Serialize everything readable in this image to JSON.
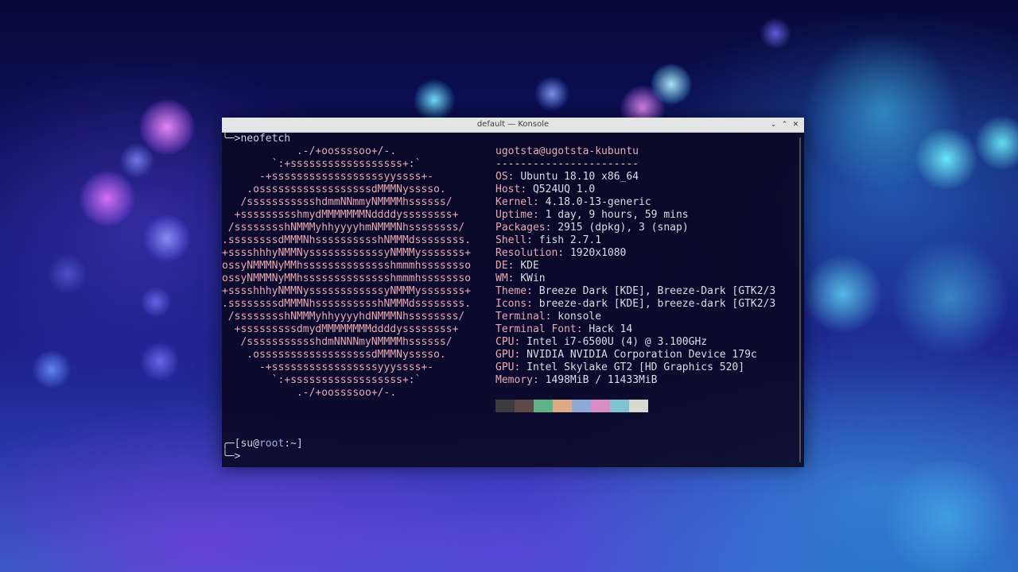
{
  "window": {
    "title": "default — Konsole"
  },
  "terminal": {
    "command_line": "╰─>neofetch",
    "header": "ugotsta@ugotsta-kubuntu",
    "separator": "-----------------------",
    "info": [
      {
        "key": "OS",
        "value": "Ubuntu 18.10 x86_64"
      },
      {
        "key": "Host",
        "value": "Q524UQ 1.0"
      },
      {
        "key": "Kernel",
        "value": "4.18.0-13-generic"
      },
      {
        "key": "Uptime",
        "value": "1 day, 9 hours, 59 mins"
      },
      {
        "key": "Packages",
        "value": "2915 (dpkg), 3 (snap)"
      },
      {
        "key": "Shell",
        "value": "fish 2.7.1"
      },
      {
        "key": "Resolution",
        "value": "1920x1080"
      },
      {
        "key": "DE",
        "value": "KDE"
      },
      {
        "key": "WM",
        "value": "KWin"
      },
      {
        "key": "Theme",
        "value": "Breeze Dark [KDE], Breeze-Dark [GTK2/3"
      },
      {
        "key": "Icons",
        "value": "breeze-dark [KDE], breeze-dark [GTK2/3"
      },
      {
        "key": "Terminal",
        "value": "konsole"
      },
      {
        "key": "Terminal Font",
        "value": "Hack 14"
      },
      {
        "key": "CPU",
        "value": "Intel i7-6500U (4) @ 3.100GHz"
      },
      {
        "key": "GPU",
        "value": "NVIDIA NVIDIA Corporation Device 179c"
      },
      {
        "key": "GPU",
        "value": "Intel Skylake GT2 [HD Graphics 520]"
      },
      {
        "key": "Memory",
        "value": "1498MiB / 11433MiB"
      }
    ],
    "ascii_logo": [
      "            .-/+oossssoo+/-.",
      "        `:+ssssssssssssssssss+:`",
      "      -+ssssssssssssssssssyyssss+-",
      "    .ossssssssssssssssssdMMMNysssso.",
      "   /ssssssssssshdmmNNmmyNMMMMhssssss/",
      "  +ssssssssshmydMMMMMMMNddddyssssssss+",
      " /sssssssshNMMMyhhyyyyhmNMMMNhssssssss/",
      ".ssssssssdMMMNhsssssssssshNMMMdssssssss.",
      "+sssshhhyNMMNyssssssssssssyNMMMysssssss+",
      "ossyNMMMNyMMhsssssssssssssshmmmhssssssso",
      "ossyNMMMNyMMhsssssssssssssshmmmhssssssso",
      "+sssshhhyNMMNyssssssssssssyNMMMysssssss+",
      ".ssssssssdMMMNhsssssssssshNMMMdssssssss.",
      " /sssssssshNMMMyhhyyyyhdNMMMNhssssssss/",
      "  +sssssssssdmydMMMMMMMMddddyssssssss+",
      "   /ssssssssssshdmNNNNmyNMMMMhssssss/",
      "    .ossssssssssssssssssdMMMNysssso.",
      "      -+sssssssssssssssssyyyssss+-",
      "        `:+ssssssssssssssssss+:`",
      "            .-/+oossssoo+/-."
    ],
    "palette": [
      "#3b3b3e",
      "#5e4848",
      "#5fb388",
      "#e0a985",
      "#8faad6",
      "#d98dc2",
      "#7fc4d0",
      "#d8d9cf"
    ],
    "prompt_user": "su",
    "prompt_at": "@",
    "prompt_host": "root",
    "prompt_path": ":~",
    "prompt_open": "╭─[",
    "prompt_close": "]",
    "prompt_arrow": "╰─>"
  }
}
